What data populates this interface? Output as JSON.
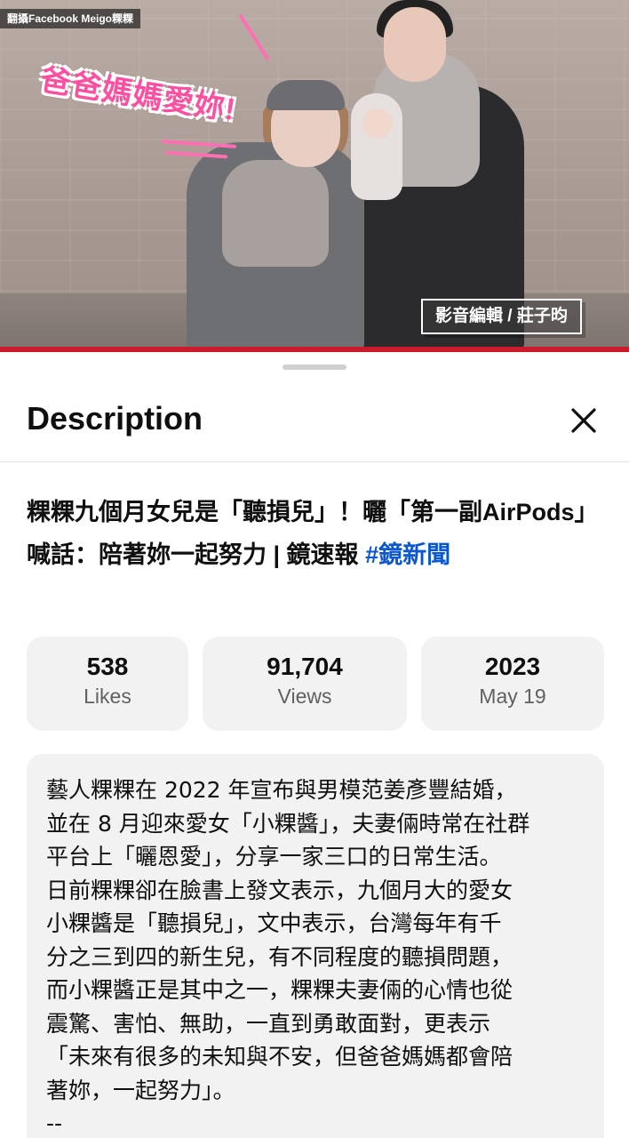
{
  "video": {
    "watermark": "翻攝Facebook Meigo粿粿",
    "sticker_text": "爸爸媽媽愛妳!",
    "editor_credit": "影音編輯 / 莊子昀"
  },
  "sheet": {
    "title": "Description",
    "close_icon": "close-icon",
    "video_title_main": "粿粿九個月女兒是「聽損兒」！曬「第一副AirPods」　喊話：陪著妳一起努力 | 鏡速報 ",
    "video_title_hashtag": "#鏡新聞"
  },
  "stats": {
    "likes_value": "538",
    "likes_label": "Likes",
    "views_value": "91,704",
    "views_label": "Views",
    "date_year": "2023",
    "date_day": "May 19"
  },
  "description": {
    "text": "藝人粿粿在 2022 年宣布與男模范姜彥豐結婚，\n並在 8 月迎來愛女「小粿醬」，夫妻倆時常在社群\n平台上「曬恩愛」，分享一家三口的日常生活。\n日前粿粿卻在臉書上發文表示，九個月大的愛女\n小粿醬是「聽損兒」，文中表示，台灣每年有千\n分之三到四的新生兒，有不同程度的聽損問題，\n而小粿醬正是其中之一，粿粿夫妻倆的心情也從\n震驚、害怕、無助，一直到勇敢面對，更表示\n「未來有很多的未知與不安，但爸爸媽媽都會陪\n著妳，一起努力」。\n--"
  },
  "colors": {
    "progress": "#cc1b2b",
    "hashtag": "#0b57d0",
    "sticker": "#ff4fa0"
  }
}
